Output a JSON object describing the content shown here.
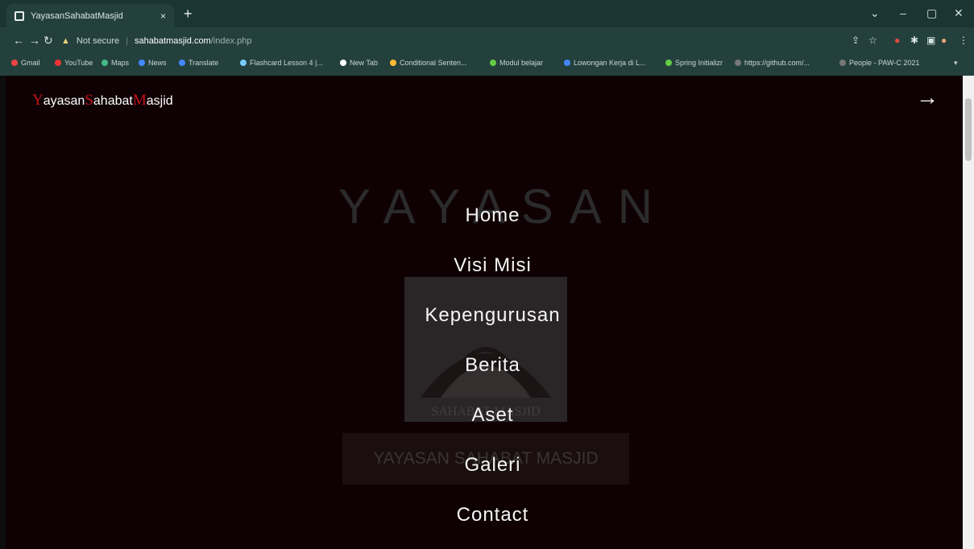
{
  "browser": {
    "tab_title": "YayasanSahabatMasjid",
    "new_tab_icon": "+",
    "url_warning": "Not secure",
    "url_host": "sahabatmasjid.com",
    "url_path": "/index.php",
    "bookmarks": [
      "Gmail",
      "YouTube",
      "Maps",
      "News",
      "Translate",
      "Flashcard Lesson 4 |...",
      "New Tab",
      "Conditional Senten...",
      "Modul belajar",
      "Lowongan Kerja di L...",
      "Spring Initializr",
      "https://github.com/...",
      "People - PAW-C 2021"
    ]
  },
  "site": {
    "brand": {
      "c1": "Y",
      "r1": "ayasan",
      "c2": "S",
      "r2": "ahabat",
      "c3": "M",
      "r3": "asjid"
    },
    "close_arrow": "→",
    "ghost_title": "YAYASAN",
    "ghost_emblem_text": "SAHABAT MASJID",
    "ghost_banner": "YAYASAN SAHABAT MASJID",
    "menu": [
      "Home",
      "Visi Misi",
      "Kepengurusan",
      "Berita",
      "Aset",
      "Galeri",
      "Contact"
    ]
  },
  "colors": {
    "accent_red": "#c4141a",
    "page_bg": "#0f0003",
    "chrome_bg": "#24403d"
  }
}
